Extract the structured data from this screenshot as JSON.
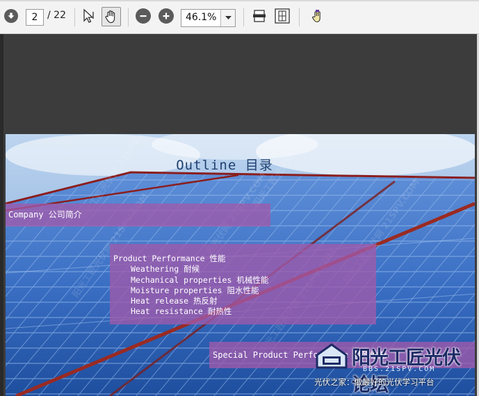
{
  "toolbar": {
    "current_page": "2",
    "total_pages": "/ 22",
    "zoom": "46.1%",
    "icons": [
      "page-down-icon",
      "select-arrow-icon",
      "hand-icon",
      "zoom-out-icon",
      "zoom-in-icon",
      "fit-width-icon",
      "fit-page-icon",
      "touch-icon"
    ]
  },
  "slide": {
    "title": "Outline   目录",
    "item1": "Company  公司简介",
    "item2_heading": "Product Performance 性能",
    "item2_subs": [
      "Weathering 耐候",
      "Mechanical properties 机械性能",
      "Moisture properties 阻水性能",
      "Heat release 热反射",
      "Heat resistance 耐热性"
    ],
    "item3": "Special Product Performance 特殊性能",
    "watermark": "阳光工匠光伏网 21SPV.COM",
    "logo_text": "阳光工匠光伏论坛",
    "logo_url": "BBS.21SPV.COM",
    "logo_slogan": "光伏之家：做最好的光伏学习平台"
  }
}
